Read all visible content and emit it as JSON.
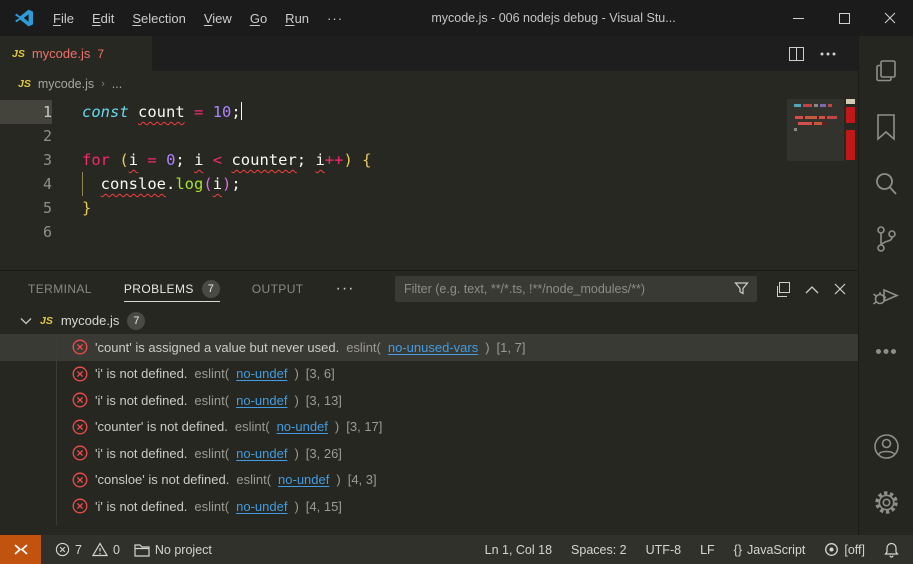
{
  "title_bar": {
    "menus": [
      "File",
      "Edit",
      "Selection",
      "View",
      "Go",
      "Run"
    ],
    "more": "···",
    "title": "mycode.js - 006 nodejs debug - Visual Stu...",
    "controls": {
      "minimize": "—",
      "maximize": "☐",
      "close": "✕"
    }
  },
  "tab": {
    "file": "mycode.js",
    "badge": "7",
    "icon": "js-icon"
  },
  "breadcrumb": {
    "file": "mycode.js",
    "separator": "›",
    "symbol": "..."
  },
  "editor": {
    "lines": [
      {
        "n": "1",
        "current": true,
        "cursor": true,
        "tokens": [
          {
            "t": "const",
            "c": "cy"
          },
          {
            "t": " ",
            "c": "fg"
          },
          {
            "t": "count",
            "c": "fg",
            "e": true
          },
          {
            "t": " ",
            "c": "fg"
          },
          {
            "t": "=",
            "c": "kw"
          },
          {
            "t": " ",
            "c": "fg"
          },
          {
            "t": "10",
            "c": "num"
          },
          {
            "t": ";",
            "c": "fg"
          }
        ]
      },
      {
        "n": "2",
        "tokens": []
      },
      {
        "n": "3",
        "tokens": [
          {
            "t": "for",
            "c": "kw"
          },
          {
            "t": " ",
            "c": "fg"
          },
          {
            "t": "(",
            "c": "b1"
          },
          {
            "t": "i",
            "c": "fg",
            "e": true
          },
          {
            "t": " ",
            "c": "fg"
          },
          {
            "t": "=",
            "c": "kw"
          },
          {
            "t": " ",
            "c": "fg"
          },
          {
            "t": "0",
            "c": "num"
          },
          {
            "t": "; ",
            "c": "fg"
          },
          {
            "t": "i",
            "c": "fg",
            "e": true
          },
          {
            "t": " ",
            "c": "fg"
          },
          {
            "t": "<",
            "c": "kw"
          },
          {
            "t": " ",
            "c": "fg"
          },
          {
            "t": "counter",
            "c": "fg",
            "e": true
          },
          {
            "t": "; ",
            "c": "fg"
          },
          {
            "t": "i",
            "c": "fg",
            "e": true
          },
          {
            "t": "++",
            "c": "kw"
          },
          {
            "t": ")",
            "c": "b1"
          },
          {
            "t": " ",
            "c": "fg"
          },
          {
            "t": "{",
            "c": "b1"
          }
        ]
      },
      {
        "n": "4",
        "guide": true,
        "tokens": [
          {
            "t": "  ",
            "c": "fg"
          },
          {
            "t": "consloe",
            "c": "fg",
            "e": true
          },
          {
            "t": ".",
            "c": "fg"
          },
          {
            "t": "log",
            "c": "fn"
          },
          {
            "t": "(",
            "c": "b2"
          },
          {
            "t": "i",
            "c": "fg",
            "e": true
          },
          {
            "t": ")",
            "c": "b2"
          },
          {
            "t": ";",
            "c": "fg"
          }
        ]
      },
      {
        "n": "5",
        "tokens": [
          {
            "t": "}",
            "c": "b1"
          }
        ]
      },
      {
        "n": "6",
        "tokens": []
      }
    ]
  },
  "panel": {
    "tabs": [
      {
        "label": "TERMINAL",
        "active": false
      },
      {
        "label": "PROBLEMS",
        "badge": "7",
        "active": true
      },
      {
        "label": "OUTPUT",
        "active": false
      }
    ],
    "more": "···",
    "filter_placeholder": "Filter (e.g. text, **/*.ts, !**/node_modules/**)",
    "tree_header": {
      "file": "mycode.js",
      "badge": "7"
    },
    "problems": [
      {
        "message": "'count' is assigned a value but never used.",
        "source": "eslint",
        "rule": "no-unused-vars",
        "position": "[1, 7]",
        "selected": true
      },
      {
        "message": "'i' is not defined.",
        "source": "eslint",
        "rule": "no-undef",
        "position": "[3, 6]",
        "selected": false
      },
      {
        "message": "'i' is not defined.",
        "source": "eslint",
        "rule": "no-undef",
        "position": "[3, 13]",
        "selected": false
      },
      {
        "message": "'counter' is not defined.",
        "source": "eslint",
        "rule": "no-undef",
        "position": "[3, 17]",
        "selected": false
      },
      {
        "message": "'i' is not defined.",
        "source": "eslint",
        "rule": "no-undef",
        "position": "[3, 26]",
        "selected": false
      },
      {
        "message": "'consloe' is not defined.",
        "source": "eslint",
        "rule": "no-undef",
        "position": "[4, 3]",
        "selected": false
      },
      {
        "message": "'i' is not defined.",
        "source": "eslint",
        "rule": "no-undef",
        "position": "[4, 15]",
        "selected": false
      }
    ]
  },
  "status_bar": {
    "errors": "7",
    "warnings": "0",
    "project": "No project",
    "cursor_position": "Ln 1, Col 18",
    "indentation": "Spaces: 2",
    "encoding": "UTF-8",
    "eol": "LF",
    "language_icon": "{}",
    "language": "JavaScript",
    "off_indicator": "[off]"
  },
  "colors": {
    "error": "#f14c4c",
    "link": "#439ce0",
    "remote_bg": "#c1530e",
    "tab_error_file": "#f0706a",
    "js_icon": "#e0ca3c",
    "keyword": "#f92672",
    "storage": "#66d9ef",
    "number": "#ae81ff",
    "function": "#a6e22e"
  }
}
